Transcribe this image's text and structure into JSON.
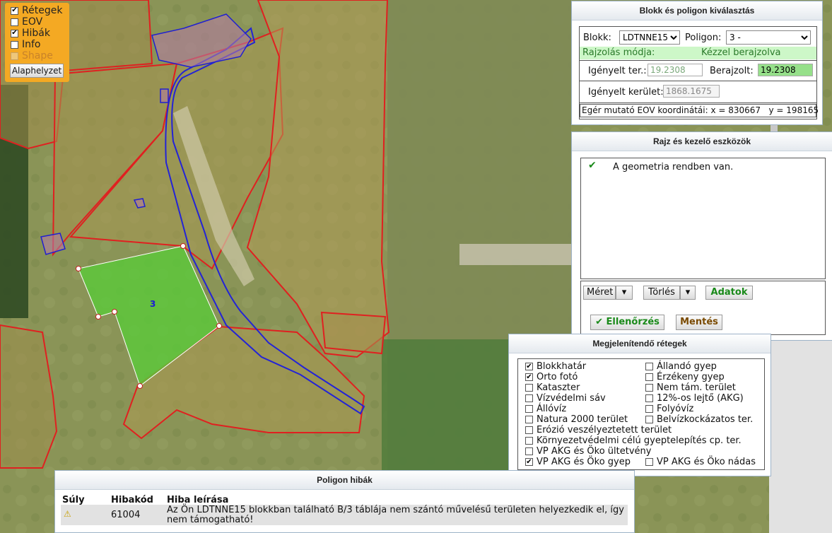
{
  "layer_panel": {
    "items": [
      {
        "label": "Rétegek",
        "checked": true
      },
      {
        "label": "EOV",
        "checked": false
      },
      {
        "label": "Hibák",
        "checked": true
      },
      {
        "label": "Info",
        "checked": false
      },
      {
        "label": "Shape",
        "checked": false,
        "disabled": true
      }
    ],
    "reset_button": "Alaphelyzet"
  },
  "map": {
    "polygon_label": "3"
  },
  "block_panel": {
    "title": "Blokk és poligon kiválasztás",
    "block_label": "Blokk:",
    "block_value": "LDTNNE15",
    "polygon_label": "Poligon:",
    "polygon_value": "3 -",
    "draw_mode_label": "Rajzolás módja:",
    "draw_mode_value": "Kézzel berajzolva",
    "requested_area_label": "Igényelt ter.:",
    "requested_area_value": "19.2308",
    "drawn_label": "Berajzolt:",
    "drawn_value": "19.2308",
    "requested_perimeter_label": "Igényelt kerület:",
    "requested_perimeter_value": "1868.1675",
    "coords_text": "Egér mutató EOV koordinátái: x = 830667   y = 198165"
  },
  "tools_panel": {
    "title": "Rajz és kezelő eszközök",
    "message": "A geometria rendben van.",
    "size_button": "Méret",
    "delete_button": "Törlés",
    "data_button": "Adatok",
    "check_button": "Ellenőrzés",
    "save_button": "Mentés"
  },
  "layers_display": {
    "title": "Megjelenítendő rétegek",
    "left": [
      {
        "label": "Blokkhatár",
        "checked": true
      },
      {
        "label": "Orto fotó",
        "checked": true
      },
      {
        "label": "Kataszter",
        "checked": false
      },
      {
        "label": "Vízvédelmi sáv",
        "checked": false
      },
      {
        "label": "Állóvíz",
        "checked": false
      },
      {
        "label": "Natura 2000 terület",
        "checked": false
      },
      {
        "label": "Erózió veszélyeztetett terület",
        "checked": false
      },
      {
        "label": "Környezetvédelmi célú gyeptelepítés cp. ter.",
        "checked": false
      },
      {
        "label": "VP AKG és Öko ültetvény",
        "checked": false
      },
      {
        "label": "VP AKG és Öko gyep",
        "checked": true
      }
    ],
    "right": [
      {
        "label": "Állandó gyep",
        "checked": false
      },
      {
        "label": "Érzékeny gyep",
        "checked": false
      },
      {
        "label": "Nem tám. terület",
        "checked": false
      },
      {
        "label": "12%-os lejtő (AKG)",
        "checked": false
      },
      {
        "label": "Folyóvíz",
        "checked": false
      },
      {
        "label": "Belvízkockázatos ter.",
        "checked": false
      },
      {
        "label": "VP AKG és Öko nádas",
        "checked": false
      }
    ]
  },
  "errors_panel": {
    "title": "Poligon hibák",
    "columns": [
      "Súly",
      "Hibakód",
      "Hiba leírása"
    ],
    "rows": [
      {
        "severity_icon": "warning-icon",
        "code": "61004",
        "description": "Az Ön LDTNNE15 blokkban található B/3 táblája nem szántó művelésű területen helyezkedik el, így nem támogatható!"
      }
    ]
  },
  "colors": {
    "accent_orange": "#f4a923",
    "block_border": "#e02020",
    "parcel_border": "#2020d0",
    "selected_fill": "#5cc83a"
  }
}
